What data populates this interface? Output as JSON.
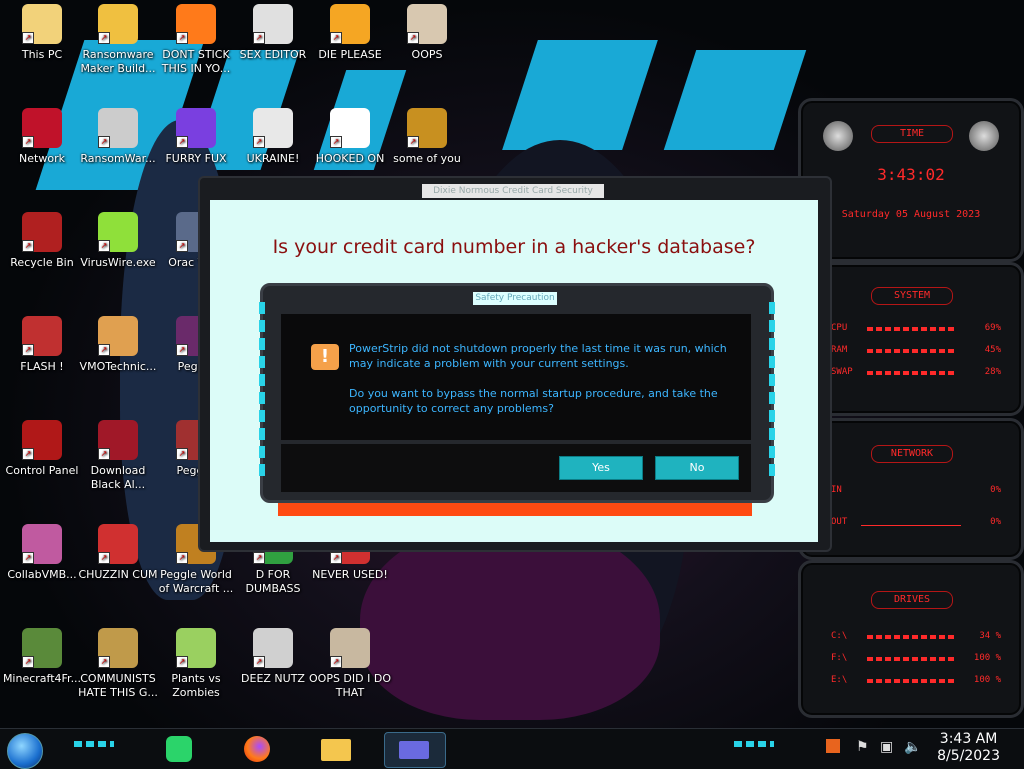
{
  "desktop_icons": [
    {
      "label": "This PC",
      "color": "#f2d27a"
    },
    {
      "label": "Ransomware Maker Build...",
      "color": "#f0c040"
    },
    {
      "label": "DONT STICK THIS IN YO...",
      "color": "#ff7a1a"
    },
    {
      "label": "SEX EDITOR",
      "color": "#e0e0e0"
    },
    {
      "label": "DIE PLEASE",
      "color": "#f5a623"
    },
    {
      "label": "OOPS",
      "color": "#d8c8b0"
    },
    {
      "label": "Network",
      "color": "#c0122a"
    },
    {
      "label": "RansomWar...",
      "color": "#cccccc"
    },
    {
      "label": "FURRY FUX",
      "color": "#7a3fe0"
    },
    {
      "label": "UKRAINE!",
      "color": "#e8e8e8"
    },
    {
      "label": "HOOKED ON",
      "color": "#ffffff"
    },
    {
      "label": "some of you",
      "color": "#c89020"
    },
    {
      "label": "Recycle Bin",
      "color": "#b02020"
    },
    {
      "label": "VirusWire.exe",
      "color": "#8fe03a"
    },
    {
      "label": "Orac Virtu",
      "color": "#5a6a8a"
    },
    {
      "label": "FLASH !",
      "color": "#c03030"
    },
    {
      "label": "VMOTechnic...",
      "color": "#e0a050"
    },
    {
      "label": "Peggle",
      "color": "#6a2a6a"
    },
    {
      "label": "Control Panel",
      "color": "#b01818"
    },
    {
      "label": "Download Black Al...",
      "color": "#a01828"
    },
    {
      "label": "Pegg D",
      "color": "#a03030"
    },
    {
      "label": "CollabVMB...",
      "color": "#c05aa0"
    },
    {
      "label": "CHUZZIN CUM",
      "color": "#d03030"
    },
    {
      "label": "Peggle World of Warcraft ...",
      "color": "#c08020"
    },
    {
      "label": "D FOR DUMBASS",
      "color": "#30a040"
    },
    {
      "label": "NEVER USED!",
      "color": "#d03030"
    },
    {
      "label": "Minecraft4Fr...",
      "color": "#5a8a3a"
    },
    {
      "label": "COMMUNISTS HATE THIS G...",
      "color": "#c09a4a"
    },
    {
      "label": "Plants vs Zombies",
      "color": "#9ad060"
    },
    {
      "label": "DEEZ NUTZ",
      "color": "#d0d0d0"
    },
    {
      "label": "OOPS DID I DO THAT",
      "color": "#c8b8a0"
    }
  ],
  "gadgets": {
    "time": {
      "header": "TIME",
      "clock": "3:43:02",
      "date": "Saturday 05 August 2023"
    },
    "system": {
      "header": "SYSTEM",
      "rows": [
        {
          "label": "CPU",
          "value": "69%"
        },
        {
          "label": "RAM",
          "value": "45%"
        },
        {
          "label": "SWAP",
          "value": "28%"
        }
      ]
    },
    "network": {
      "header": "NETWORK",
      "rows": [
        {
          "label": "IN",
          "value": "0%"
        },
        {
          "label": "OUT",
          "value": "0%"
        }
      ]
    },
    "drives": {
      "header": "DRIVES",
      "rows": [
        {
          "label": "C:\\",
          "value": "34 %"
        },
        {
          "label": "F:\\",
          "value": "100 %"
        },
        {
          "label": "E:\\",
          "value": "100 %"
        }
      ]
    }
  },
  "main_window": {
    "title": "Dixie Normous Credit Card Security",
    "headline": "Is your credit card number in a hacker's database?"
  },
  "dialog": {
    "title": "Safety Precaution",
    "message_1": "PowerStrip did not shutdown properly the last time it was run, which may indicate a problem with your current settings.",
    "message_2": "Do you want to bypass the normal startup procedure, and take the opportunity to correct any problems?",
    "yes_label": "Yes",
    "no_label": "No"
  },
  "taskbar": {
    "clock_time": "3:43 AM",
    "clock_date": "8/5/2023"
  }
}
